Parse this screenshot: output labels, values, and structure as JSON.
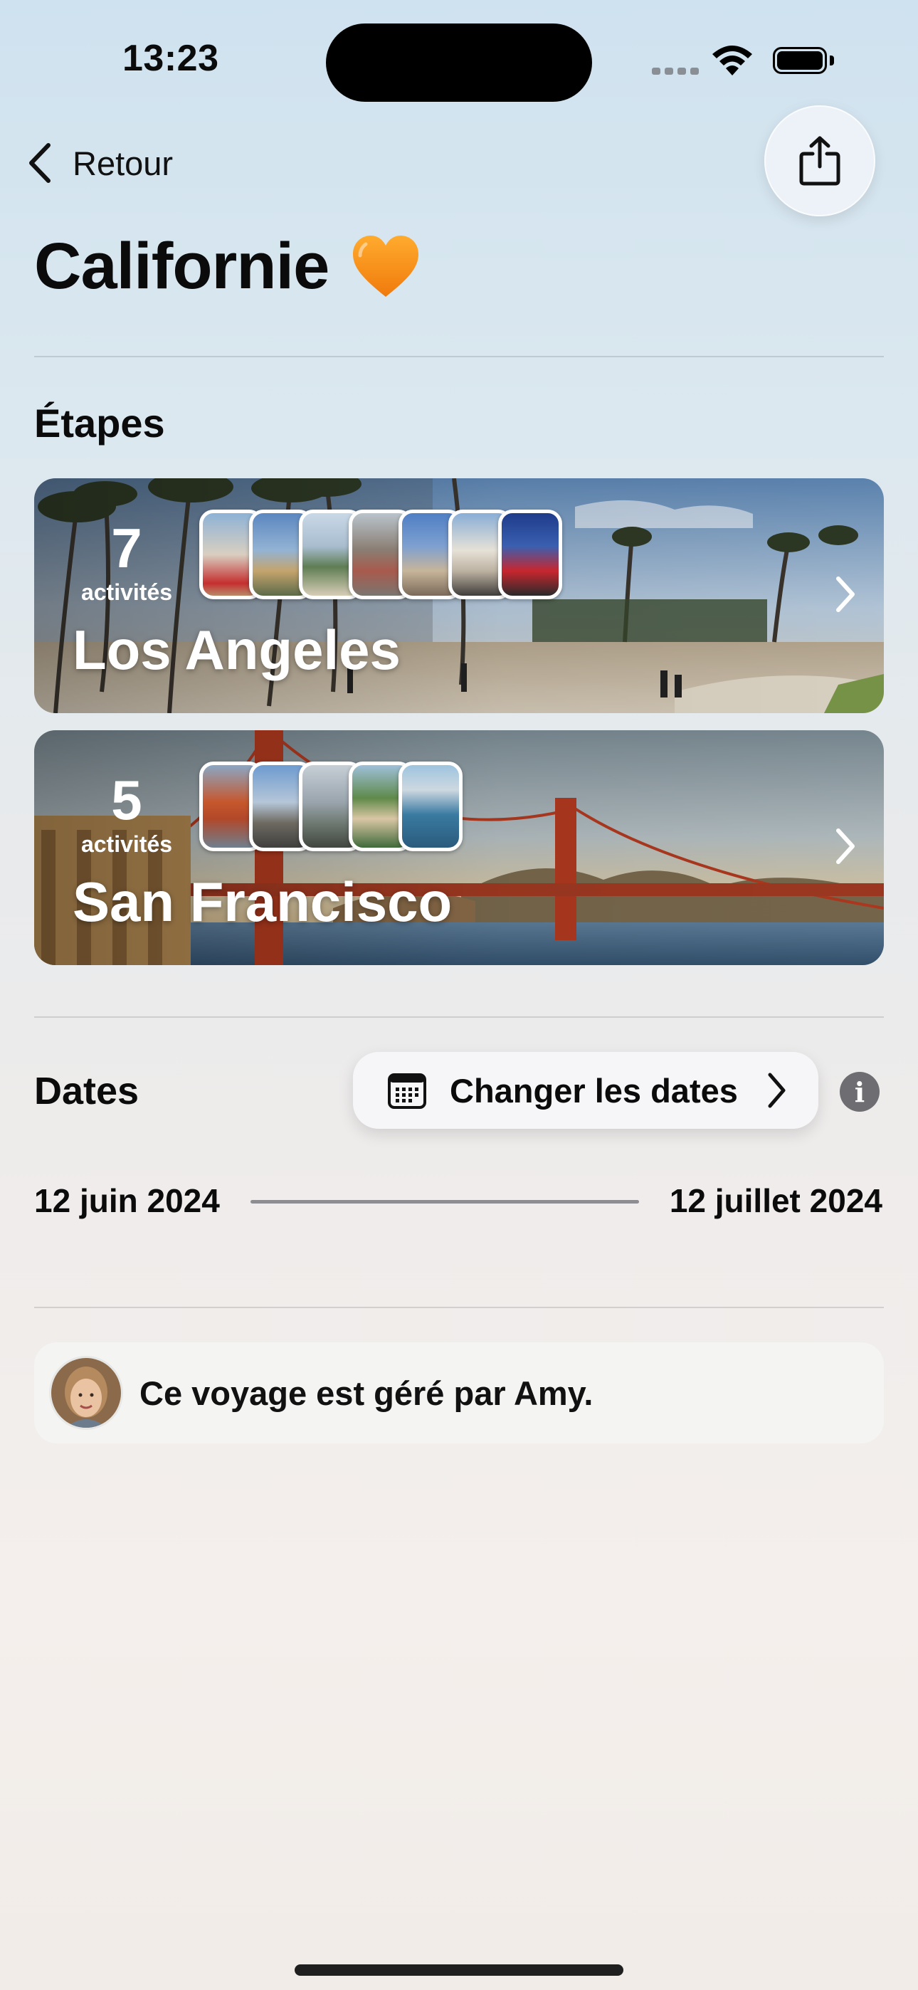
{
  "status_bar": {
    "time": "13:23"
  },
  "nav": {
    "back_label": "Retour"
  },
  "trip": {
    "title": "Californie",
    "emoji": "orange-heart"
  },
  "stages": {
    "heading": "Étapes",
    "items": [
      {
        "count": "7",
        "count_label": "activités",
        "city": "Los Angeles",
        "thumbnail_count": 7
      },
      {
        "count": "5",
        "count_label": "activités",
        "city": "San Francisco",
        "thumbnail_count": 5
      }
    ]
  },
  "dates": {
    "heading": "Dates",
    "change_button": "Changer les dates",
    "start": "12 juin 2024",
    "end": "12 juillet 2024"
  },
  "manager": {
    "text": "Ce voyage est géré par Amy."
  },
  "icons": {
    "back": "chevron-left-icon",
    "share": "share-icon",
    "calendar": "calendar-icon",
    "info": "info-icon",
    "chevron": "chevron-right-icon"
  }
}
